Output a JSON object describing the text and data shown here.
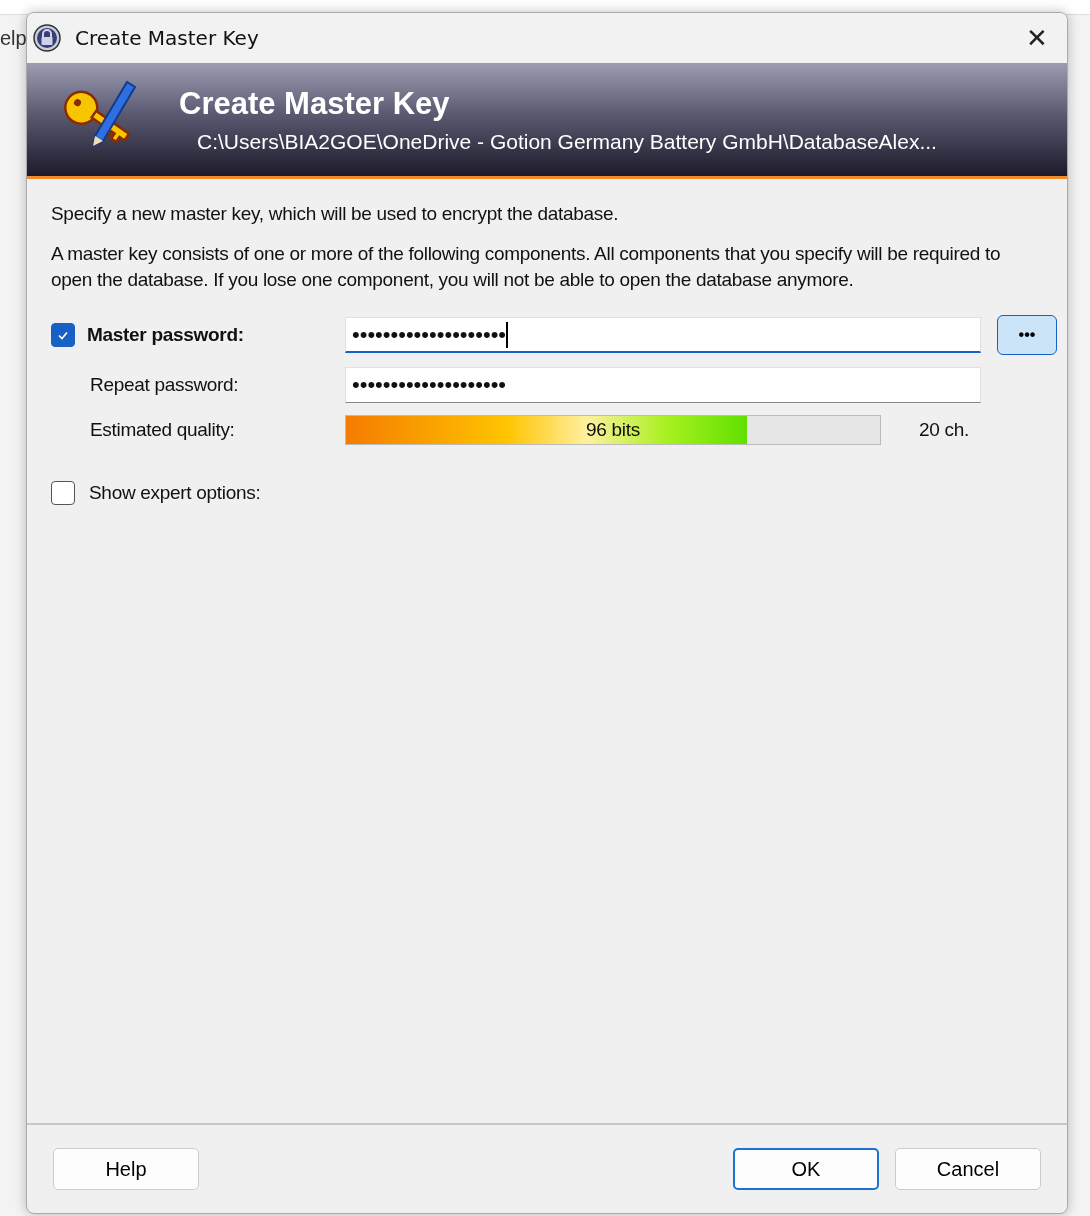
{
  "background_window": {
    "menu_text": "elp"
  },
  "window": {
    "title": "Create Master Key",
    "close": "✕"
  },
  "banner": {
    "title": "Create Master Key",
    "path": "C:\\Users\\BIA2GOE\\OneDrive - Gotion Germany Battery GmbH\\DatabaseAlex..."
  },
  "intro": "Specify a new master key, which will be used to encrypt the database.",
  "description": "A master key consists of one or more of the following components. All components that you specify will be required to open the database. If you lose one component, you will not be able to open the database anymore.",
  "master_password": {
    "label": "Master password:",
    "checked": true,
    "value": "••••••••••••••••••••",
    "focused": true,
    "reveal_button": "•••"
  },
  "repeat_password": {
    "label": "Repeat password:",
    "value": "••••••••••••••••••••"
  },
  "quality": {
    "label": "Estimated quality:",
    "level": 0.75,
    "reading": "96 bits",
    "length": "20 ch."
  },
  "expert_options": {
    "label": "Show expert options:",
    "checked": false
  },
  "buttons": [
    {
      "label": "Help",
      "default": false
    },
    {
      "label": "OK",
      "default": true
    },
    {
      "label": "Cancel",
      "default": false
    }
  ]
}
